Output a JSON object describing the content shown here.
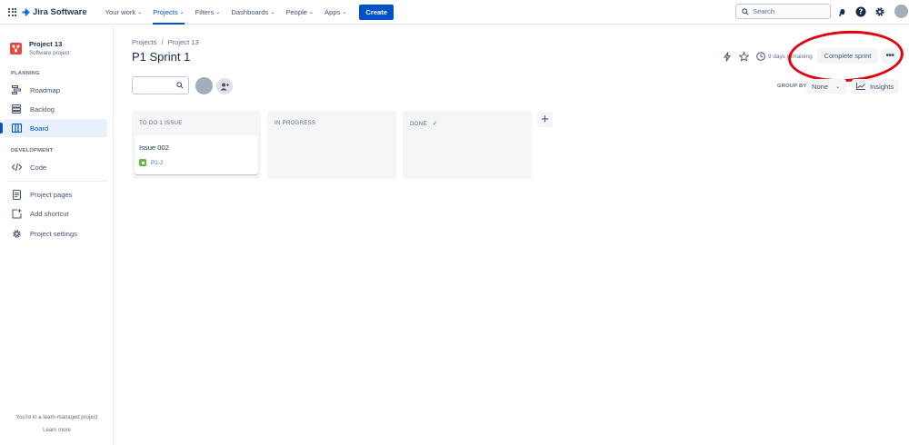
{
  "topnav": {
    "product": "Jira Software",
    "items": [
      {
        "label": "Your work",
        "active": false
      },
      {
        "label": "Projects",
        "active": true
      },
      {
        "label": "Filters",
        "active": false
      },
      {
        "label": "Dashboards",
        "active": false
      },
      {
        "label": "People",
        "active": false
      },
      {
        "label": "Apps",
        "active": false
      }
    ],
    "create_label": "Create",
    "search_placeholder": "Search",
    "icons": [
      "notifications-icon",
      "help-icon",
      "settings-icon"
    ]
  },
  "sidebar": {
    "project_name": "Project 13",
    "project_type": "Software project",
    "planning_title": "PLANNING",
    "planning_items": [
      {
        "label": "Roadmap",
        "icon": "roadmap-icon"
      },
      {
        "label": "Backlog",
        "icon": "backlog-icon"
      },
      {
        "label": "Board",
        "icon": "board-icon",
        "active": true
      }
    ],
    "development_title": "DEVELOPMENT",
    "development_items": [
      {
        "label": "Code",
        "icon": "code-icon"
      }
    ],
    "other_items": [
      {
        "label": "Project pages",
        "icon": "pages-icon"
      },
      {
        "label": "Add shortcut",
        "icon": "add-shortcut-icon"
      },
      {
        "label": "Project settings",
        "icon": "settings-icon"
      }
    ],
    "footer_text": "You're in a team-managed project",
    "footer_link": "Learn more"
  },
  "main": {
    "breadcrumb": [
      "Projects",
      "/",
      "Project 13"
    ],
    "title": "P1 Sprint 1",
    "days_remaining": "9 days remaining",
    "complete_sprint_label": "Complete sprint",
    "more_label": "•••",
    "group_by_label": "GROUP BY",
    "group_by_value": "None",
    "insights_label": "Insights",
    "columns": [
      {
        "title": "TO DO 1 ISSUE",
        "cards": [
          {
            "title": "Issue 002",
            "key": "P1-2"
          }
        ]
      },
      {
        "title": "IN PROGRESS",
        "cards": []
      },
      {
        "title": "DONE",
        "cards": [],
        "done_check": "✓"
      }
    ],
    "add_column_label": "+"
  },
  "colors": {
    "brand": "#0052cc",
    "annotation": "#e3000f",
    "story": "#63ba3c",
    "project_icon": "#e5493a"
  }
}
